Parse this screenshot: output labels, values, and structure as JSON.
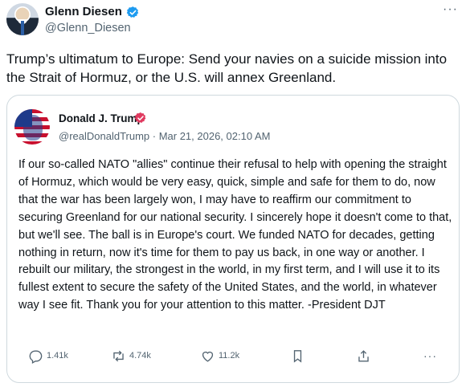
{
  "post": {
    "author": {
      "name": "Glenn Diesen",
      "handle": "@Glenn_Diesen"
    },
    "more_label": "···",
    "text": "Trump’s ultimatum to Europe: Send your navies on a suicide mission into the Strait of Hormuz, or the U.S. will annex Greenland."
  },
  "quote": {
    "author": {
      "name": "Donald J. Trump",
      "meta": "@realDonaldTrump · Mar 21, 2026, 02:10 AM"
    },
    "text": "If our so-called NATO \"allies\" continue their refusal to help with opening the straight of Hormuz, which would be very easy, quick, simple and safe for them to do, now that the war has been largely won, I may have to reaffirm our commitment to securing Greenland for our national security. I sincerely hope it doesn't come to that, but we'll see. The ball is in Europe's court. We funded NATO for decades, getting nothing in return, now it's time for them to pay us back, in one way or another. I rebuilt our military, the strongest in the world, in my first term, and I will use it to its fullest extent to secure the safety of the United States, and the world, in whatever way I see fit. Thank you for your attention to this matter. -President DJT",
    "stats": {
      "replies": "1.41k",
      "reposts": "4.74k",
      "likes": "11.2k"
    },
    "more_label": "···"
  },
  "colors": {
    "verified_blue": "#1d9bf0",
    "truth_badge": "#e03a5f",
    "border": "#cfd9de",
    "secondary_text": "#536471"
  },
  "icons": [
    "verified-badge-icon",
    "truth-verified-icon",
    "reply-icon",
    "repost-icon",
    "like-icon",
    "bookmark-icon",
    "share-icon",
    "more-icon"
  ]
}
